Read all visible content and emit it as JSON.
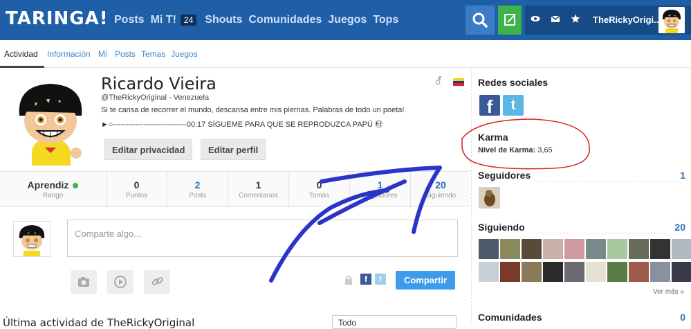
{
  "topbar": {
    "logo": "TARINGA!",
    "nav": [
      "Posts",
      "Mi T!",
      "Shouts",
      "Comunidades",
      "Juegos",
      "Tops"
    ],
    "mi_t_badge": "24",
    "username": "TheRickyOrigi...",
    "colors": {
      "bar": "#1f5fa8",
      "search": "#3c7cc6",
      "write": "#3db349",
      "userbox": "#174b86"
    }
  },
  "subnav": {
    "tabs": [
      "Actividad",
      "Información",
      "Mi",
      "Posts",
      "Temas",
      "Juegos"
    ],
    "active": "Actividad"
  },
  "profile": {
    "name": "Ricardo Vieira",
    "handle": "@TheRickyOriginal - Venezuela",
    "bio_line1": "Si te cansa de recorrer el mundo, descansa entre mis piernas. Palabras de todo un poeta!",
    "bio_line2": "►○-----------------------------00:17 SÍGUEME PARA QUE SE REPRODUZCA PAPÚ ㉹",
    "btn_privacy": "Editar privacidad",
    "btn_edit": "Editar perfil",
    "gender_icon": "male-symbol-icon"
  },
  "stats": [
    {
      "value": "Aprendiz",
      "label": "Rango"
    },
    {
      "value": "0",
      "label": "Puntos"
    },
    {
      "value": "2",
      "label": "Posts"
    },
    {
      "value": "1",
      "label": "Comentarios"
    },
    {
      "value": "0",
      "label": "Temas"
    },
    {
      "value": "1",
      "label": "Seguidores"
    },
    {
      "value": "20",
      "label": "Siguiendo"
    }
  ],
  "composer": {
    "placeholder": "Comparte algo...",
    "share_label": "Compartir",
    "fb": "f",
    "tw": "t"
  },
  "activity": {
    "title": "Última actividad de TheRickyOriginal",
    "select_value": "Todo"
  },
  "sidebar": {
    "social_title": "Redes sociales",
    "karma_title": "Karma",
    "karma_label": "Nivel de Karma:",
    "karma_value": "3,65",
    "followers_title": "Seguidores",
    "followers_count": "1",
    "following_title": "Siguiendo",
    "following_count": "20",
    "see_more": "Ver más »",
    "communities_title": "Comunidades",
    "communities_count": "0"
  }
}
